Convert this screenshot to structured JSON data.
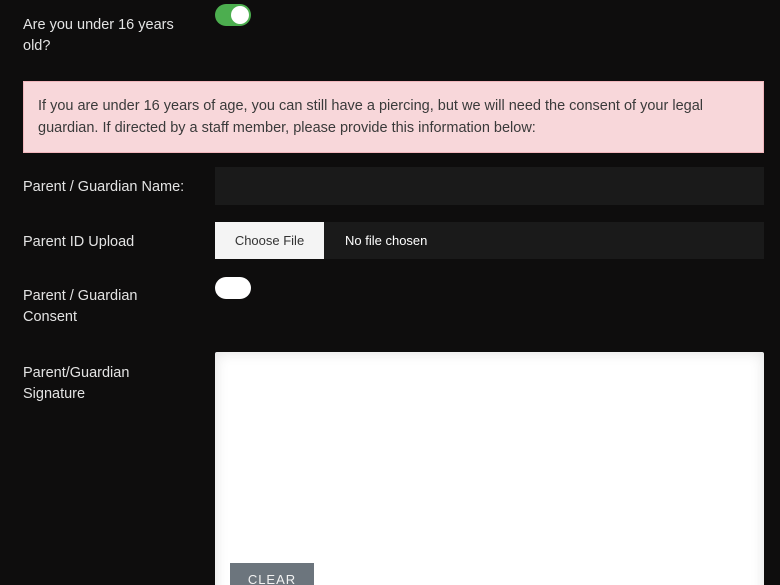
{
  "age_question": {
    "label": "Are you under 16 years old?",
    "toggle_state": "on"
  },
  "alert": {
    "text": "If you are under 16 years of age, you can still have a piercing, but we will need the consent of your legal guardian. If directed by a staff member, please provide this information below:",
    "background_color": "#f8d7da"
  },
  "guardian_name": {
    "label": "Parent / Guardian Name:",
    "value": "",
    "placeholder": ""
  },
  "parent_id": {
    "label": "Parent ID Upload",
    "button_label": "Choose File",
    "status": "No file chosen"
  },
  "guardian_consent": {
    "label": "Parent / Guardian Consent",
    "toggle_state": "off"
  },
  "signature": {
    "label": "Parent/Guardian Signature",
    "clear_label": "CLEAR"
  },
  "colors": {
    "background": "#0e0d0d",
    "toggle_on": "#4cae4f",
    "input_background": "#1a1a1a",
    "clear_button": "#6c757d"
  }
}
